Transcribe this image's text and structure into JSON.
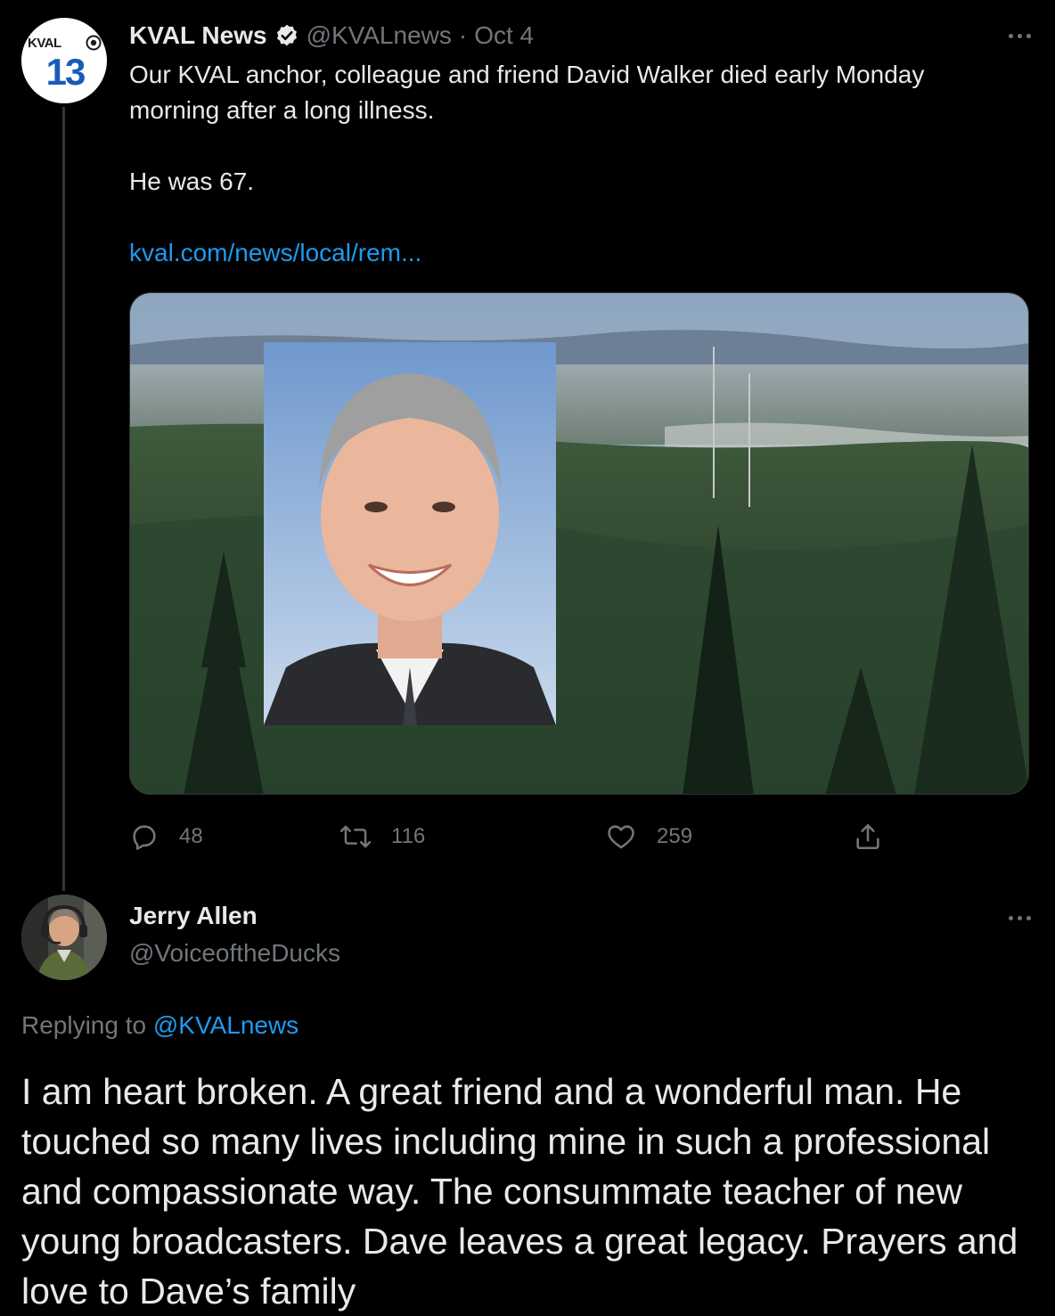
{
  "main_tweet": {
    "author_name": "KVAL News",
    "author_handle": "@KVALnews",
    "separator": "·",
    "date": "Oct 4",
    "avatar_text_top": "KVAL",
    "avatar_text_number": "13",
    "text_line1": "Our KVAL anchor, colleague and friend David Walker died early Monday morning after a long illness.",
    "text_line2": "He was 67.",
    "link_text": "kval.com/news/local/rem...",
    "stats": {
      "replies": "48",
      "retweets": "116",
      "likes": "259"
    }
  },
  "reply_tweet": {
    "author_name": "Jerry Allen",
    "author_handle": "@VoiceoftheDucks",
    "replying_prefix": "Replying to",
    "replying_to": "@KVALnews",
    "text": "I am heart broken. A great friend and a wonderful man. He touched so many lives including mine in such a professional and compassionate way. The consummate teacher of new young broadcasters. Dave leaves a great legacy. Prayers and love to Dave’s family"
  },
  "icons": {
    "verified": "verified-badge-icon",
    "more": "more-icon",
    "reply": "reply-icon",
    "retweet": "retweet-icon",
    "like": "heart-icon",
    "share": "share-icon"
  },
  "colors": {
    "background": "#000000",
    "text": "#e7e9ea",
    "muted": "#71767b",
    "link": "#1d9bf0",
    "kval_blue": "#1a5bb8"
  }
}
